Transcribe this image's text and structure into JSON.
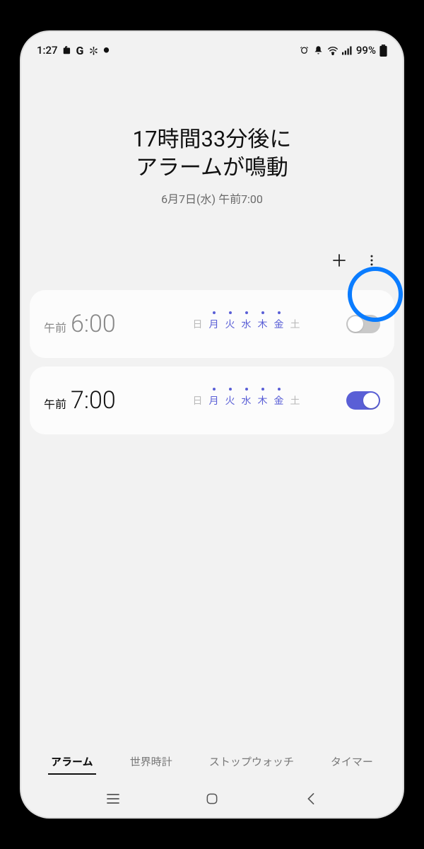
{
  "status": {
    "time": "1:27",
    "battery": "99%"
  },
  "header": {
    "title_line1": "17時間33分後に",
    "title_line2": "アラームが鳴動",
    "subtitle": "6月7日(水) 午前7:00"
  },
  "days_labels": [
    "日",
    "月",
    "火",
    "水",
    "木",
    "金",
    "土"
  ],
  "alarms": [
    {
      "ampm": "午前",
      "time": "6:00",
      "selected": [
        false,
        true,
        true,
        true,
        true,
        true,
        false
      ],
      "on": false
    },
    {
      "ampm": "午前",
      "time": "7:00",
      "selected": [
        false,
        true,
        true,
        true,
        true,
        true,
        false
      ],
      "on": true
    }
  ],
  "tabs": {
    "alarm": "アラーム",
    "world": "世界時計",
    "stopwatch": "ストップウォッチ",
    "timer": "タイマー",
    "active": "alarm"
  }
}
